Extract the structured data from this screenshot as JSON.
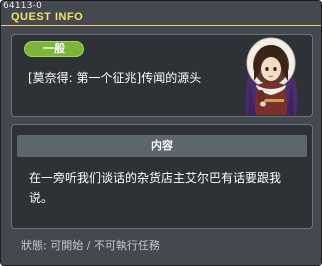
{
  "window": {
    "quest_id": "64113-0",
    "title": "QUEST INFO"
  },
  "quest": {
    "category_badge": "一般",
    "name": "[莫奈得: 第一个征兆]传闻的源头",
    "npc_portrait": "hooded-woman-npc-portrait"
  },
  "content": {
    "header": "内容",
    "description": "在一旁听我们谈话的杂货店主艾尔巴有话要跟我说。"
  },
  "status": {
    "text": "狀態:  可開始 / 不可執行任務"
  },
  "colors": {
    "window_bg": "#43494f",
    "panel_bg": "#2e3237",
    "title_yellow": "#f4e36a",
    "badge_green": "#7db53a",
    "header_gray": "#5d656d"
  }
}
